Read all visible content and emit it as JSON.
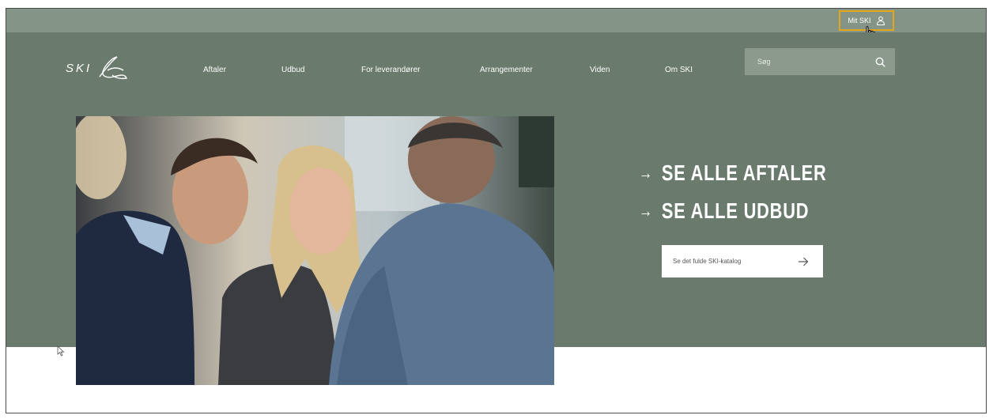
{
  "topbar": {
    "account_label": "Mit SKI"
  },
  "header": {
    "logo_text": "SKI",
    "nav": [
      {
        "label": "Aftaler"
      },
      {
        "label": "Udbud"
      },
      {
        "label": "For leverandører"
      },
      {
        "label": "Arrangementer"
      },
      {
        "label": "Viden"
      },
      {
        "label": "Om SKI"
      }
    ],
    "search": {
      "placeholder": "Søg",
      "value": ""
    }
  },
  "hero": {
    "links": [
      {
        "label": "SE ALLE AFTALER"
      },
      {
        "label": "SE ALLE UDBUD"
      }
    ],
    "arrow_glyph": "→",
    "catalog_button": "Se det fulde SKI-katalog"
  },
  "colors": {
    "topbar": "#849486",
    "hero_bg": "#6a7a6c",
    "search_bg": "#8c9a8e",
    "highlight_border": "#e0a81a"
  },
  "icons": [
    "person-icon",
    "search-icon",
    "arrow-right-icon",
    "hand-cursor-icon",
    "pointer-cursor-icon",
    "logo-mark-icon"
  ]
}
